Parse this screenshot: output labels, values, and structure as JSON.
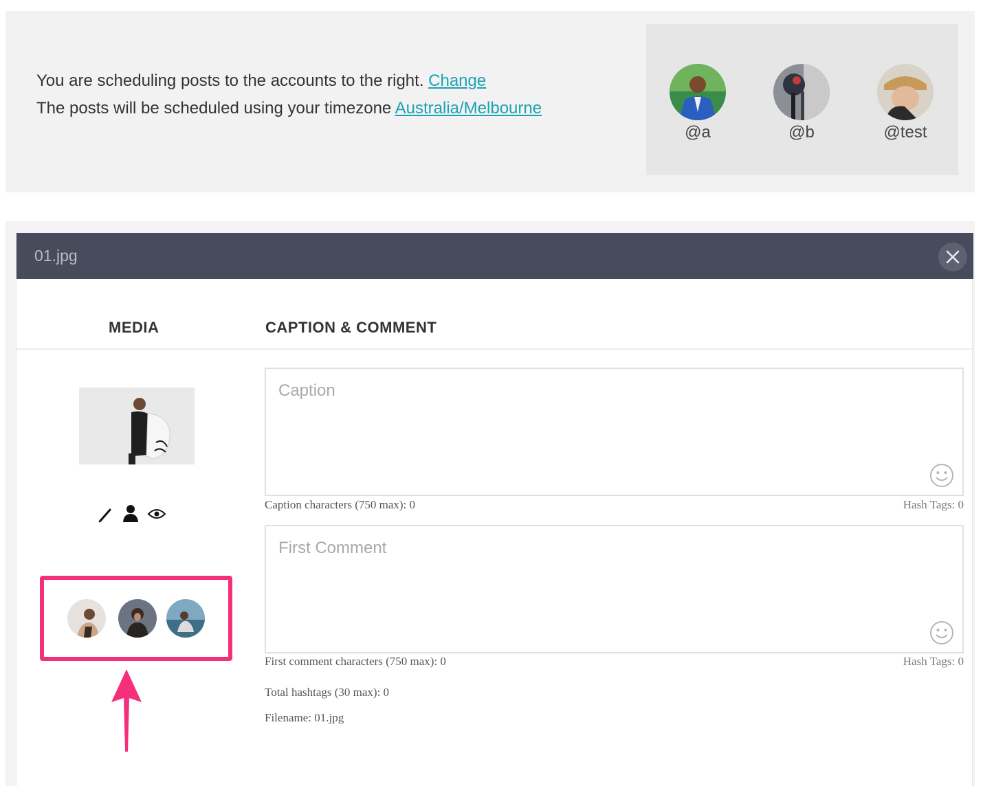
{
  "banner": {
    "line1": "You are scheduling posts to the accounts to the right.",
    "change_link": "Change",
    "line2": "The posts will be scheduled using your timezone",
    "timezone_link": "Australia/Melbourne",
    "accounts": [
      {
        "handle": "@a"
      },
      {
        "handle": "@b"
      },
      {
        "handle": "@test"
      }
    ]
  },
  "editor": {
    "title": "01.jpg",
    "tabs": {
      "media": "MEDIA",
      "caption": "CAPTION & COMMENT"
    },
    "caption": {
      "placeholder": "Caption",
      "count_label": "Caption characters (750 max): 0",
      "hashtags_label": "Hash Tags: 0"
    },
    "comment": {
      "placeholder": "First Comment",
      "count_label": "First comment characters (750 max): 0",
      "hashtags_label": "Hash Tags: 0"
    },
    "total_hashtags": "Total hashtags (30 max): 0",
    "filename": "Filename: 01.jpg"
  },
  "colors": {
    "accent_link": "#1aa3b3",
    "header_bg": "#474b5c",
    "highlight": "#f5307a"
  },
  "icons": [
    "close-icon",
    "pencil-icon",
    "person-icon",
    "eye-icon",
    "emoji-icon",
    "arrow-up-icon"
  ]
}
